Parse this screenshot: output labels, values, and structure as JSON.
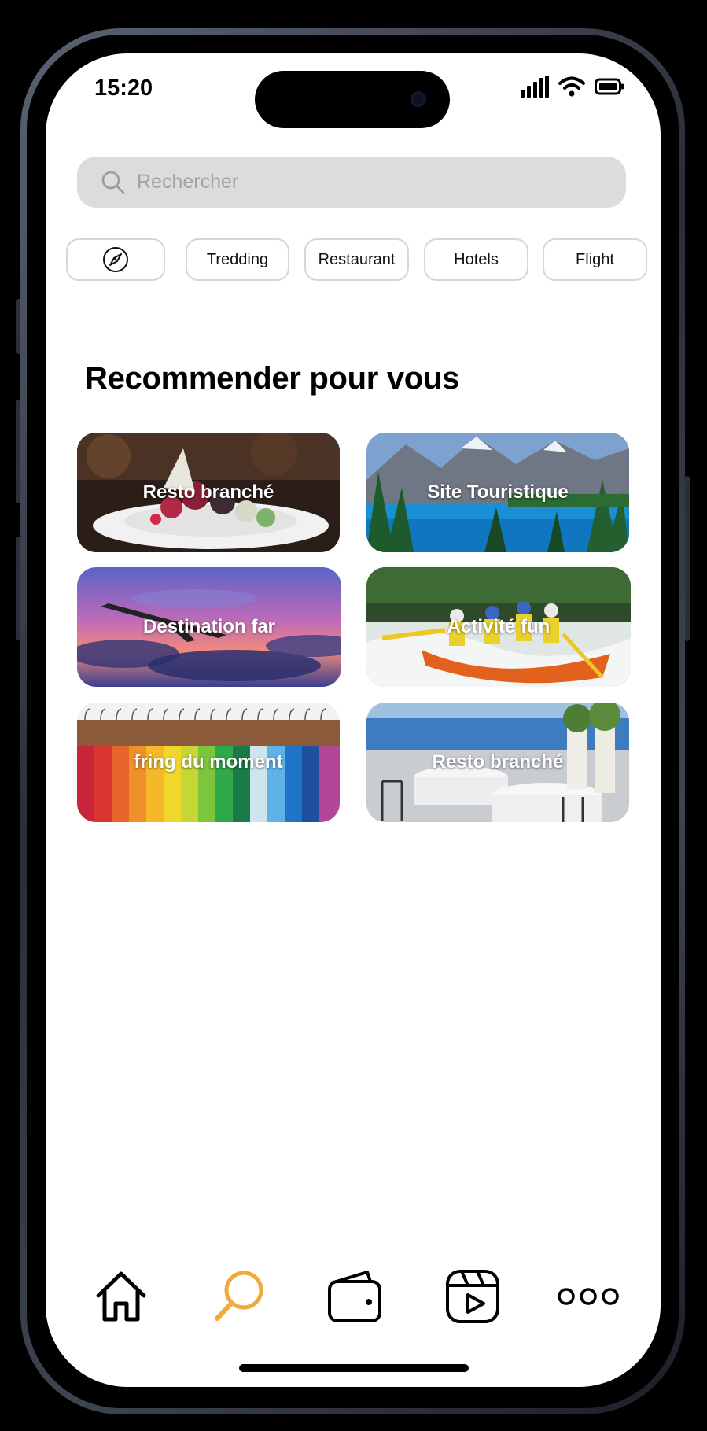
{
  "status": {
    "time": "15:20"
  },
  "search": {
    "placeholder": "Rechercher"
  },
  "chips": [
    {
      "label": "",
      "icon": "compass-icon"
    },
    {
      "label": "Tredding"
    },
    {
      "label": "Restaurant"
    },
    {
      "label": "Hotels"
    },
    {
      "label": "Flight"
    }
  ],
  "section": {
    "title": "Recommender pour vous"
  },
  "cards": [
    {
      "label": "Resto branché"
    },
    {
      "label": "Site Touristique"
    },
    {
      "label": "Destination far"
    },
    {
      "label": "Activité fun"
    },
    {
      "label": "fring du moment"
    },
    {
      "label": "Resto branché"
    }
  ],
  "tabbar": {
    "items": [
      {
        "icon": "home-icon"
      },
      {
        "icon": "search-icon",
        "active": true
      },
      {
        "icon": "wallet-icon"
      },
      {
        "icon": "reels-icon"
      },
      {
        "icon": "more-icon"
      }
    ],
    "accent": "#f2a93b"
  }
}
